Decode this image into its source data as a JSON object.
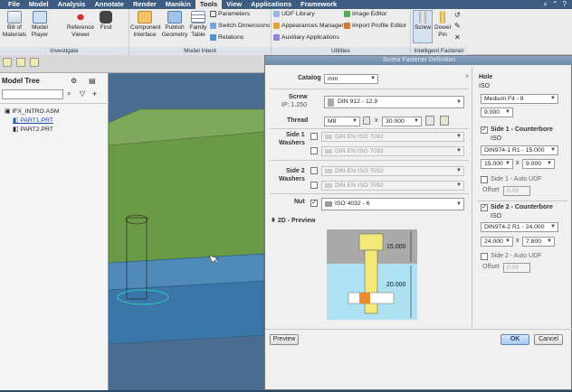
{
  "menubar": {
    "tabs": [
      "File",
      "Model",
      "Analysis",
      "Annotate",
      "Render",
      "Manikin",
      "Tools",
      "View",
      "Applications",
      "Framework"
    ],
    "active_tab": "Tools"
  },
  "ribbon": {
    "investigate": {
      "label": "Investigate",
      "bill": "Bill of Materials",
      "player": "Model Player",
      "reference": "Reference Viewer",
      "find": "Find"
    },
    "model_intent": {
      "label": "Model Intent",
      "component": "Component Interface",
      "publish": "Publish Geometry",
      "family": "Family Table",
      "parameters": "Parameters",
      "switch": "Switch Dimensions",
      "relations": "Relations"
    },
    "utilities": {
      "label": "Utilities",
      "udf": "UDF Library",
      "appearances": "Appearances Manager",
      "auxiliary": "Auxiliary Applications",
      "image_editor": "Image Editor",
      "import_profile": "Import Profile Editor"
    },
    "intelligent_fastener": {
      "label": "Intelligent Fastener",
      "screw": "Screw",
      "dowel": "Dowel Pin"
    }
  },
  "tree": {
    "title": "Model Tree",
    "items": [
      "IFX_INTRO.ASM",
      "PART1.PRT",
      "PART2.PRT"
    ]
  },
  "dialog": {
    "title": "Screw Fastener Definition",
    "catalog_label": "Catalog",
    "catalog_value": "mm",
    "screw_label": "Screw",
    "ip_label": "IP: 1.250",
    "screw_value": "DIN 912 - 12.9",
    "thread_label": "Thread",
    "thread_size": "M8",
    "times": "x",
    "thread_length": "30.000",
    "side1_washers_label": "Side 1",
    "washers_label": "Washers",
    "side1_washer_values": [
      "DIN EN ISO 7092",
      "DIN EN ISO 7092"
    ],
    "side2_washers_label": "Side 2",
    "side2_washer_values": [
      "DIN EN ISO 7092",
      "DIN EN ISO 7092"
    ],
    "nut_label": "Nut",
    "nut_value": "ISO 4032 - 6",
    "preview_label": "2D - Preview",
    "preview_dims": [
      "15.000",
      "20.000"
    ],
    "hole_label": "Hole",
    "hole_standard": "ISO",
    "hole_fit": "Medium Fit - 9",
    "hole_diameter": "9.000",
    "side1_counterbore": "Side 1 - Counterbore",
    "side1_std": "ISO",
    "side1_cb_value": "DIN974-1 R1 - 15.000",
    "side1_d": "15.000",
    "side1_x": "x",
    "side1_depth": "9.000",
    "side1_auto_udf": "Side 1 - Auto UDF",
    "offset_label": "Offset",
    "offset1": "0.00",
    "side2_counterbore": "Side 2 - Counterbore",
    "side2_std": "ISO",
    "side2_cb_value": "DIN974-2 R1 - 24.000",
    "side2_d": "24.000",
    "side2_x": "x",
    "side2_depth": "7.800",
    "side2_auto_udf": "Side 2 - Auto UDF",
    "offset2": "0.00",
    "preview_button": "Preview",
    "ok_button": "OK",
    "cancel_button": "Cancel"
  }
}
